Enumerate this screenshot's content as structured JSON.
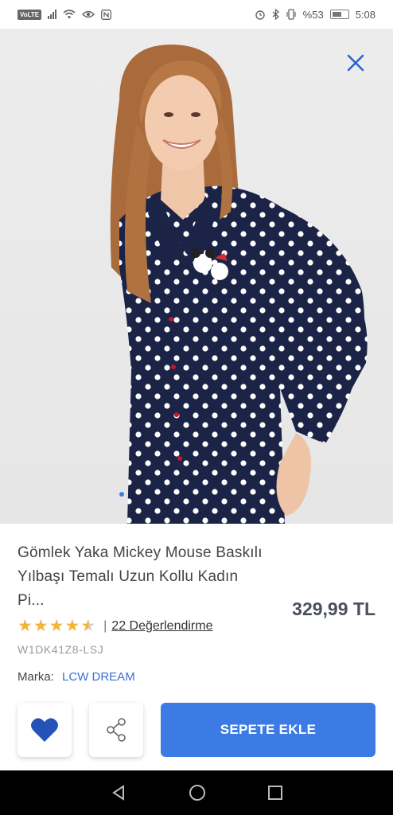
{
  "status_bar": {
    "volte": "VoLTE",
    "battery_percent": "%53",
    "time": "5:08"
  },
  "product": {
    "title": "Gömlek Yaka Mickey Mouse Baskılı Yılbaşı Temalı Uzun Kollu Kadın Pi...",
    "price": "329,99 TL",
    "rating": 4.5,
    "rating_separator": "|",
    "reviews_label": "22 Değerlendirme",
    "sku": "W1DK41Z8-LSJ",
    "brand_label": "Marka:",
    "brand_value": "LCW DREAM"
  },
  "actions": {
    "add_to_cart_label": "SEPETE EKLE"
  },
  "gallery": {
    "page_count": 1,
    "current_page": 1
  },
  "icons": {
    "close": "close-icon",
    "favorite": "heart-icon",
    "share": "share-icon"
  },
  "colors": {
    "accent": "#3c7be3",
    "star": "#f1b53b",
    "pajama_navy": "#1b2346"
  }
}
